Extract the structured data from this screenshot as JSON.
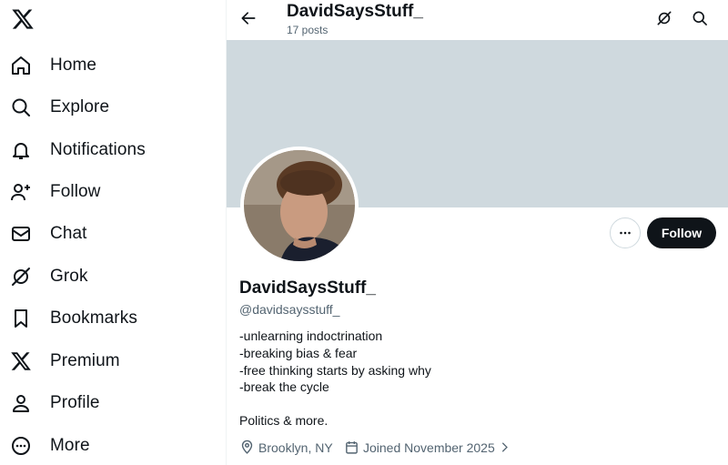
{
  "sidebar": {
    "logo_icon": "x-logo-icon",
    "items": [
      {
        "label": "Home",
        "icon": "home-icon"
      },
      {
        "label": "Explore",
        "icon": "search-icon"
      },
      {
        "label": "Notifications",
        "icon": "bell-icon"
      },
      {
        "label": "Follow",
        "icon": "person-add-icon"
      },
      {
        "label": "Chat",
        "icon": "envelope-icon"
      },
      {
        "label": "Grok",
        "icon": "grok-icon"
      },
      {
        "label": "Bookmarks",
        "icon": "bookmark-icon"
      },
      {
        "label": "Premium",
        "icon": "x-logo-icon"
      },
      {
        "label": "Profile",
        "icon": "person-icon"
      },
      {
        "label": "More",
        "icon": "more-circle-icon"
      }
    ]
  },
  "header": {
    "title": "DavidSaysStuff_",
    "post_count": "17 posts"
  },
  "profile": {
    "display_name": "DavidSaysStuff_",
    "handle": "@davidsaysstuff_",
    "bio": [
      "-unlearning indoctrination",
      "-breaking bias & fear",
      "-free thinking starts by asking why",
      "-break the cycle",
      "",
      "Politics & more."
    ],
    "location": "Brooklyn, NY",
    "joined": "Joined November 2025",
    "follow_label": "Follow"
  },
  "colors": {
    "banner": "#cfd9de",
    "text_primary": "#0f1419",
    "text_secondary": "#536471",
    "button_dark": "#0f1419"
  }
}
